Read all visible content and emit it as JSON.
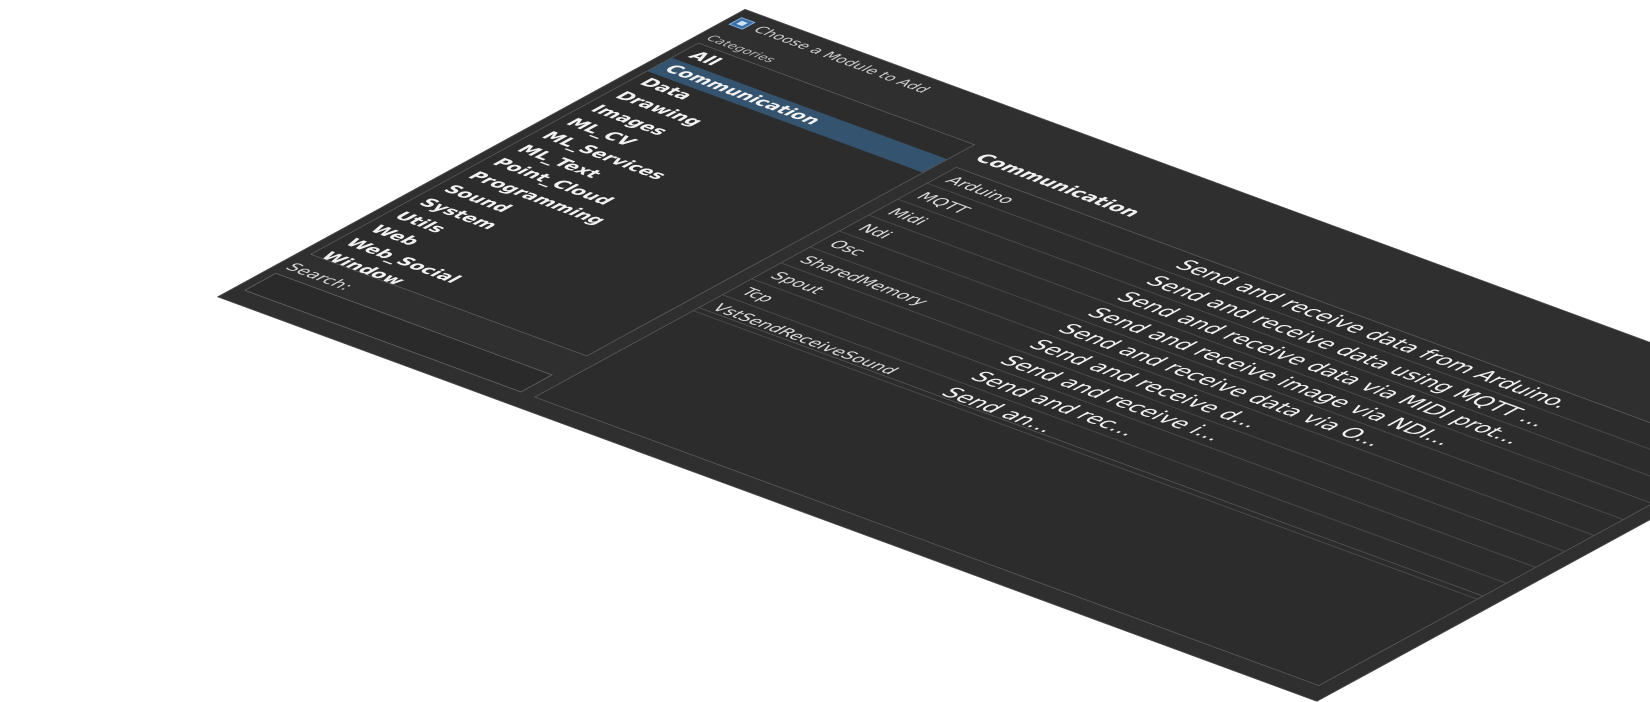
{
  "window": {
    "title": "Choose a Module to Add",
    "help_label": "?",
    "close_label": "✕"
  },
  "categories": {
    "label": "Categories",
    "items": [
      {
        "label": "All"
      },
      {
        "label": "Communication",
        "selected": true
      },
      {
        "label": "Data"
      },
      {
        "label": "Drawing"
      },
      {
        "label": "Images"
      },
      {
        "label": "ML_CV"
      },
      {
        "label": "ML_Services"
      },
      {
        "label": "ML_Text"
      },
      {
        "label": "Point_Cloud"
      },
      {
        "label": "Programming"
      },
      {
        "label": "Sound"
      },
      {
        "label": "System"
      },
      {
        "label": "Utils"
      },
      {
        "label": "Web"
      },
      {
        "label": "Web_Social"
      },
      {
        "label": "Window"
      }
    ]
  },
  "search": {
    "label": "Search:",
    "value": ""
  },
  "modules": {
    "heading": "Communication",
    "rows": [
      {
        "name": "Arduino",
        "description": "Send and receive data from Arduino."
      },
      {
        "name": "MQTT",
        "description": "Send and receive data using MQTT ..."
      },
      {
        "name": "Midi",
        "description": "Send and receive data via MIDI prot..."
      },
      {
        "name": "Ndi",
        "description": "Send and receive image via NDI..."
      },
      {
        "name": "Osc",
        "description": "Send and receive data via O..."
      },
      {
        "name": "SharedMemory",
        "description": "Send and receive d..."
      },
      {
        "name": "Spout",
        "description": "Send and receive i..."
      },
      {
        "name": "Tcp",
        "description": "Send and rec..."
      },
      {
        "name": "VstSendReceiveSound",
        "description": "Send an..."
      }
    ]
  },
  "colors": {
    "background": "#2f2f2f",
    "selection": "#34536e",
    "border": "#5a5a5a"
  }
}
